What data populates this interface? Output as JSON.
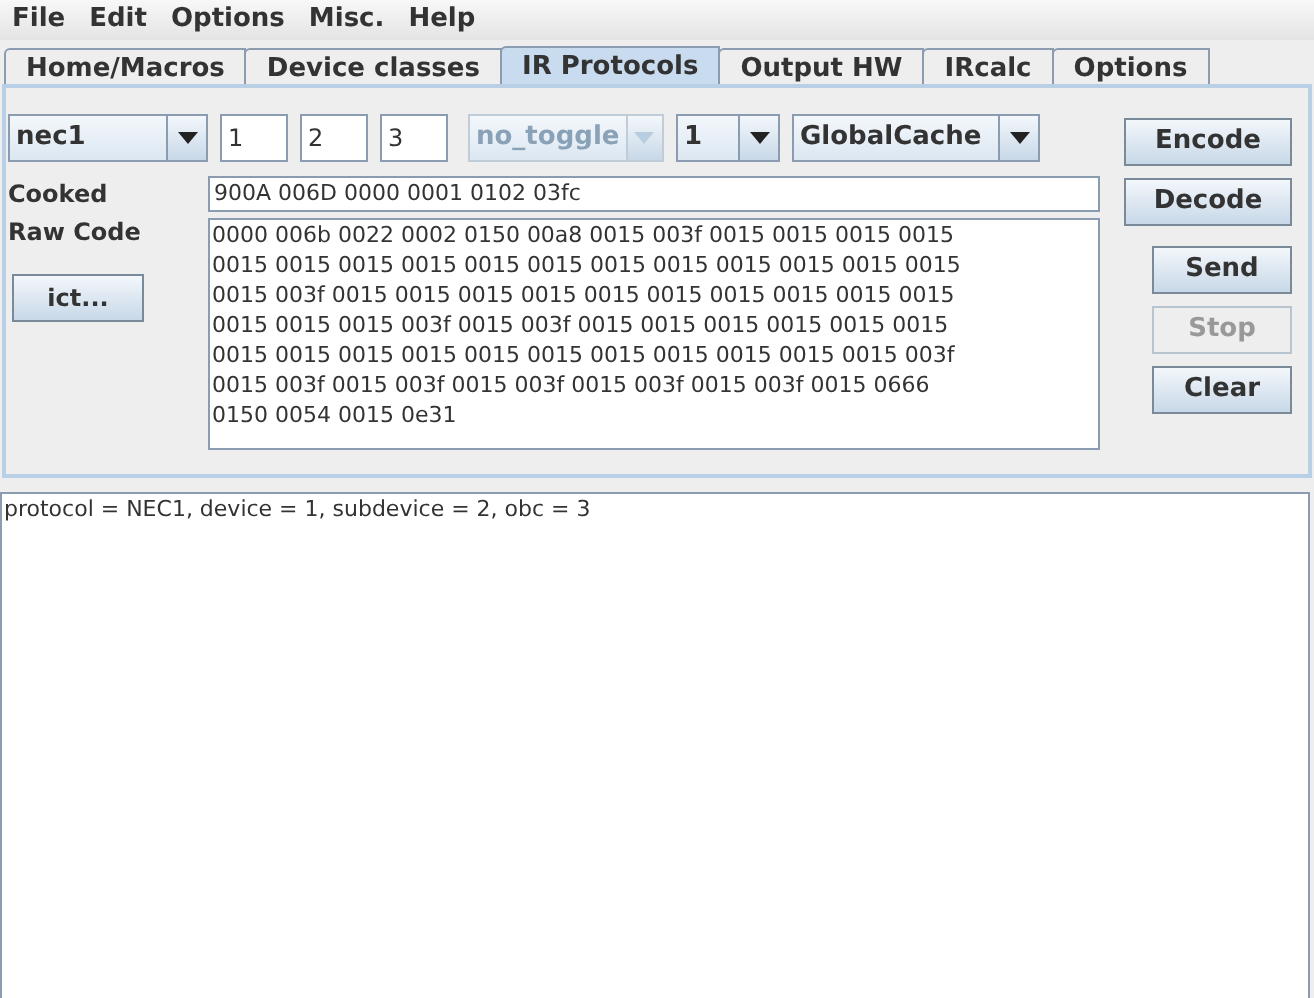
{
  "menu": [
    {
      "label": "File"
    },
    {
      "label": "Edit"
    },
    {
      "label": "Options"
    },
    {
      "label": "Misc."
    },
    {
      "label": "Help"
    }
  ],
  "tabs": [
    {
      "label": "Home/Macros",
      "selected": false
    },
    {
      "label": "Device classes",
      "selected": false
    },
    {
      "label": "IR Protocols",
      "selected": true
    },
    {
      "label": "Output HW",
      "selected": false
    },
    {
      "label": "IRcalc",
      "selected": false
    },
    {
      "label": "Options",
      "selected": false
    }
  ],
  "protocol": {
    "value": "nec1"
  },
  "params": [
    {
      "value": "1"
    },
    {
      "value": "2"
    },
    {
      "value": "3"
    }
  ],
  "toggle": {
    "value": "no_toggle",
    "disabled": true
  },
  "count": {
    "value": "1"
  },
  "format": {
    "value": "GlobalCache"
  },
  "cooked": {
    "label": "Cooked",
    "value": "900A 006D 0000 0001 0102 03fc"
  },
  "raw": {
    "label": "Raw Code",
    "lines": [
      "0000 006b 0022 0002 0150 00a8 0015 003f 0015 0015 0015 0015",
      "0015 0015 0015 0015 0015 0015 0015 0015 0015 0015 0015 0015",
      "0015 003f 0015 0015 0015 0015 0015 0015 0015 0015 0015 0015",
      "0015 0015 0015 003f 0015 003f 0015 0015 0015 0015 0015 0015",
      "0015 0015 0015 0015 0015 0015 0015 0015 0015 0015 0015 003f",
      "0015 003f 0015 003f 0015 003f 0015 003f 0015 003f 0015 0666",
      "0150 0054 0015 0e31"
    ]
  },
  "ict_button": {
    "label": "ict..."
  },
  "buttons": [
    {
      "label": "Encode",
      "disabled": false
    },
    {
      "label": "Decode",
      "disabled": false
    },
    {
      "label": "Send",
      "disabled": false
    },
    {
      "label": "Stop",
      "disabled": true
    },
    {
      "label": "Clear",
      "disabled": false
    }
  ],
  "output": {
    "text": "protocol = NEC1, device = 1, subdevice = 2, obc = 3"
  }
}
